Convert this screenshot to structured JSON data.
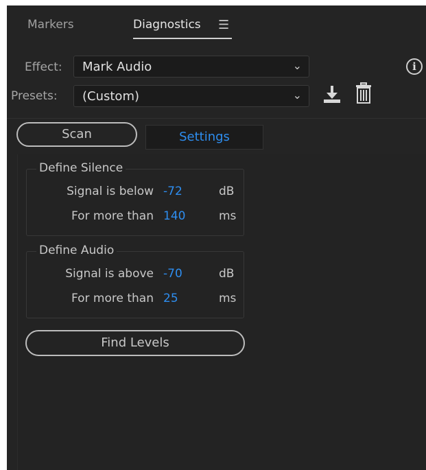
{
  "tabs": {
    "markers": "Markers",
    "diagnostics": "Diagnostics",
    "menu_icon": "hamburger-menu-icon"
  },
  "effect": {
    "label": "Effect:",
    "value": "Mark Audio"
  },
  "presets": {
    "label": "Presets:",
    "value": "(Custom)"
  },
  "icons": {
    "info": "info-icon",
    "save_preset": "download-icon",
    "delete_preset": "trash-icon"
  },
  "mode_tabs": {
    "scan": "Scan",
    "settings": "Settings"
  },
  "define_silence": {
    "title": "Define Silence",
    "signal_label": "Signal is below",
    "signal_value": "-72",
    "signal_unit": "dB",
    "duration_label": "For more than",
    "duration_value": "140",
    "duration_unit": "ms"
  },
  "define_audio": {
    "title": "Define Audio",
    "signal_label": "Signal is above",
    "signal_value": "-70",
    "signal_unit": "dB",
    "duration_label": "For more than",
    "duration_value": "25",
    "duration_unit": "ms"
  },
  "find_levels": "Find Levels",
  "colors": {
    "accent": "#2e8ef0",
    "panel_bg": "#242424",
    "field_bg": "#1b1b1b"
  }
}
